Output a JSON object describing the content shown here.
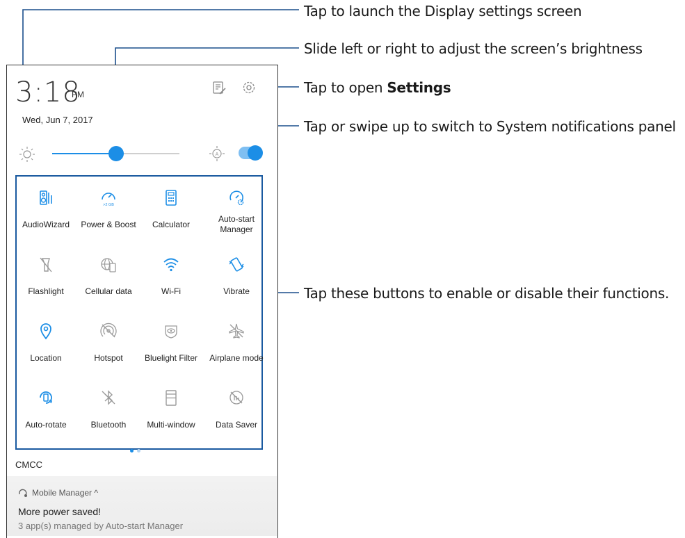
{
  "callouts": {
    "display": "Tap to launch the Display settings screen",
    "brightness": "Slide left or right to adjust the screen’s brightness",
    "settings_prefix": "Tap to open ",
    "settings_bold": "Settings",
    "system": "Tap or swipe up to switch to System notifications panel",
    "buttons": "Tap these buttons to enable or disable their functions."
  },
  "status": {
    "time": "3:18",
    "ampm": "PM",
    "date": "Wed, Jun 7, 2017"
  },
  "brightness": {
    "level": 0.5,
    "auto": true
  },
  "quick_settings": [
    {
      "label": "AudioWizard",
      "icon": "audiowizard-icon",
      "active": true
    },
    {
      "label": "Power & Boost",
      "icon": "power-boost-icon",
      "active": true,
      "badge": ">2 GB"
    },
    {
      "label": "Calculator",
      "icon": "calculator-icon",
      "active": true
    },
    {
      "label": "Auto-start\nManager",
      "icon": "autostart-manager-icon",
      "active": true
    },
    {
      "label": "Flashlight",
      "icon": "flashlight-icon",
      "active": false
    },
    {
      "label": "Cellular data",
      "icon": "cellular-data-icon",
      "active": false
    },
    {
      "label": "Wi-Fi",
      "icon": "wifi-icon",
      "active": true
    },
    {
      "label": "Vibrate",
      "icon": "vibrate-icon",
      "active": true
    },
    {
      "label": "Location",
      "icon": "location-icon",
      "active": true
    },
    {
      "label": "Hotspot",
      "icon": "hotspot-icon",
      "active": false
    },
    {
      "label": "Bluelight Filter",
      "icon": "bluelight-filter-icon",
      "active": false
    },
    {
      "label": "Airplane mode",
      "icon": "airplane-icon",
      "active": false
    },
    {
      "label": "Auto-rotate",
      "icon": "autorotate-icon",
      "active": true
    },
    {
      "label": "Bluetooth",
      "icon": "bluetooth-icon",
      "active": false
    },
    {
      "label": "Multi-window",
      "icon": "multiwindow-icon",
      "active": false
    },
    {
      "label": "Data Saver",
      "icon": "data-saver-icon",
      "active": false
    }
  ],
  "carrier": "CMCC",
  "notification": {
    "app": "Mobile Manager",
    "title": "More power saved!",
    "body": "3 app(s) managed by Auto-start Manager"
  },
  "colors": {
    "accent": "#1c8ee6",
    "inactive": "#9a9a9a",
    "frame": "#1a5aa0"
  }
}
